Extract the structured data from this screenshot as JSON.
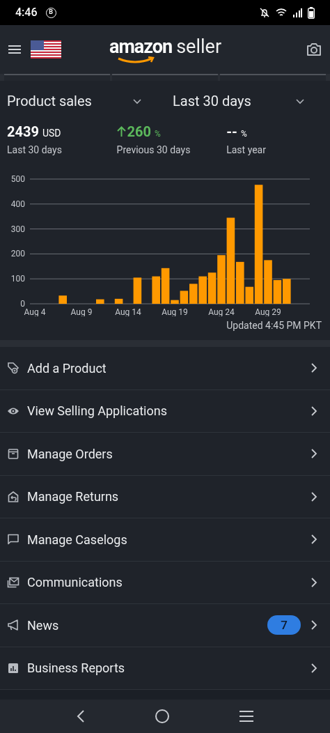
{
  "status_bar": {
    "time": "4:46",
    "notification_glyph": "B"
  },
  "header": {
    "logo_word": "amazon",
    "logo_suffix": "seller"
  },
  "sales": {
    "metric": "Product sales",
    "period": "Last 30 days",
    "stats": [
      {
        "kind": "amount",
        "value": "2439",
        "unit": "USD",
        "label": "Last 30 days"
      },
      {
        "kind": "up",
        "value": "260",
        "unit": "%",
        "label": "Previous 30 days"
      },
      {
        "kind": "none",
        "value": "--",
        "unit": "%",
        "label": "Last year"
      }
    ],
    "chart_data": {
      "type": "bar",
      "grid": true,
      "categories": [
        "Aug 4",
        null,
        null,
        null,
        null,
        "Aug 9",
        null,
        null,
        null,
        null,
        "Aug 14",
        null,
        null,
        null,
        null,
        "Aug 19",
        null,
        null,
        null,
        null,
        "Aug 24",
        null,
        null,
        null,
        null,
        "Aug 29",
        null,
        null
      ],
      "series": [
        {
          "color": "#ff9900",
          "values": [
            0,
            0,
            0,
            33,
            0,
            0,
            0,
            18,
            0,
            20,
            0,
            105,
            0,
            110,
            143,
            15,
            52,
            80,
            110,
            125,
            195,
            345,
            168,
            68,
            477,
            175,
            95,
            100
          ]
        }
      ],
      "ylim": [
        0,
        500
      ],
      "yticks": [
        0,
        100,
        200,
        300,
        400,
        500
      ]
    },
    "updated": "Updated 4:45 PM PKT"
  },
  "menu": [
    {
      "kind": "tag",
      "label": "Add a Product"
    },
    {
      "kind": "eye",
      "label": "View Selling Applications"
    },
    {
      "kind": "box",
      "label": "Manage Orders"
    },
    {
      "kind": "return",
      "label": "Manage Returns"
    },
    {
      "kind": "chat",
      "label": "Manage Caselogs"
    },
    {
      "kind": "mail",
      "label": "Communications"
    },
    {
      "kind": "megaphone",
      "label": "News",
      "badge": "7"
    },
    {
      "kind": "report",
      "label": "Business Reports"
    }
  ]
}
